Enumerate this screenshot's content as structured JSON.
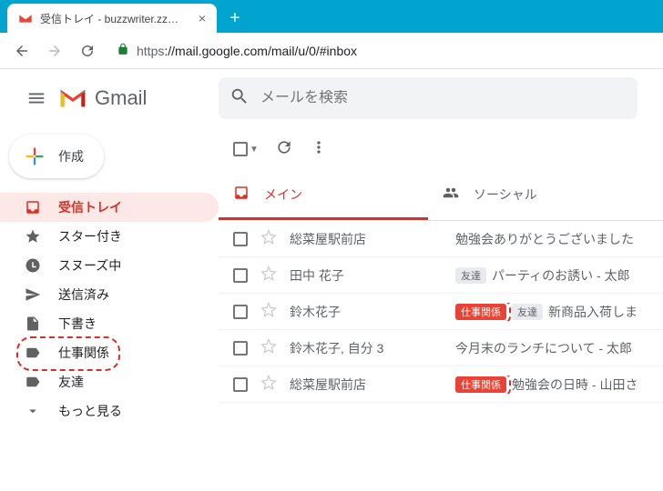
{
  "browser": {
    "tab_title": "受信トレイ - buzzwriter.zz@gmail.",
    "url_scheme": "https",
    "url_rest": "://mail.google.com/mail/u/0/#inbox"
  },
  "header": {
    "logo_text": "Gmail",
    "search_placeholder": "メールを検索"
  },
  "compose": {
    "label": "作成"
  },
  "sidebar": {
    "items": [
      {
        "label": "受信トレイ",
        "icon": "inbox-icon",
        "active": true
      },
      {
        "label": "スター付き",
        "icon": "star-icon"
      },
      {
        "label": "スヌーズ中",
        "icon": "clock-icon"
      },
      {
        "label": "送信済み",
        "icon": "send-icon"
      },
      {
        "label": "下書き",
        "icon": "draft-icon"
      },
      {
        "label": "仕事関係",
        "icon": "label-icon",
        "highlighted": true
      },
      {
        "label": "友達",
        "icon": "label-icon"
      },
      {
        "label": "もっと見る",
        "icon": "chevron-down-icon"
      }
    ]
  },
  "categories": [
    {
      "label": "メイン",
      "icon": "inbox-icon",
      "active": true
    },
    {
      "label": "ソーシャル",
      "icon": "people-icon"
    }
  ],
  "colors": {
    "accent": "#d93025",
    "browser_chrome": "#01a4ce"
  },
  "mails": [
    {
      "sender": "総菜屋駅前店",
      "tags": [],
      "subject": "勉強会ありがとうございました"
    },
    {
      "sender": "田中 花子",
      "tags": [
        {
          "text": "友達",
          "kind": "friend"
        }
      ],
      "subject": "パーティのお誘い - 太郎"
    },
    {
      "sender": "鈴木花子",
      "tags": [
        {
          "text": "仕事関係",
          "kind": "work",
          "highlight": true
        },
        {
          "text": "友達",
          "kind": "friend"
        }
      ],
      "subject": "新商品入荷しま"
    },
    {
      "sender": "鈴木花子, 自分 3",
      "tags": [],
      "subject": "今月末のランチについて - 太郎"
    },
    {
      "sender": "総菜屋駅前店",
      "tags": [
        {
          "text": "仕事関係",
          "kind": "work",
          "highlight": true
        }
      ],
      "subject": "勉強会の日時 - 山田さ"
    }
  ]
}
